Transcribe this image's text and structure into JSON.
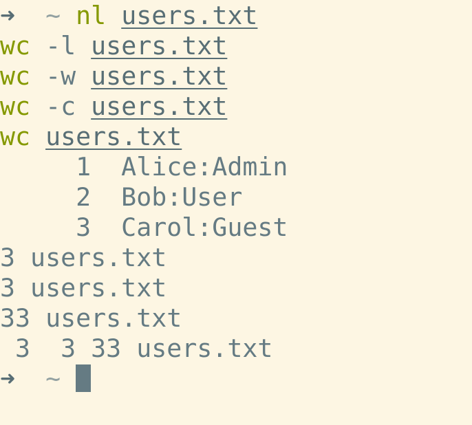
{
  "terminal": {
    "prompt": {
      "arrow": "➜",
      "dir": "~"
    },
    "commands": [
      {
        "cmd": "nl",
        "args": "",
        "file": "users.txt"
      },
      {
        "cmd": "wc",
        "args": "-l",
        "file": "users.txt"
      },
      {
        "cmd": "wc",
        "args": "-w",
        "file": "users.txt"
      },
      {
        "cmd": "wc",
        "args": "-c",
        "file": "users.txt"
      },
      {
        "cmd": "wc",
        "args": "",
        "file": "users.txt"
      }
    ],
    "output": [
      "     1  Alice:Admin",
      "     2  Bob:User",
      "     3  Carol:Guest",
      "3 users.txt",
      "3 users.txt",
      "33 users.txt",
      " 3  3 33 users.txt"
    ],
    "colors": {
      "background": "#fdf6e3",
      "text": "#657b83",
      "command": "#859900",
      "cursor": "#657b83"
    }
  }
}
